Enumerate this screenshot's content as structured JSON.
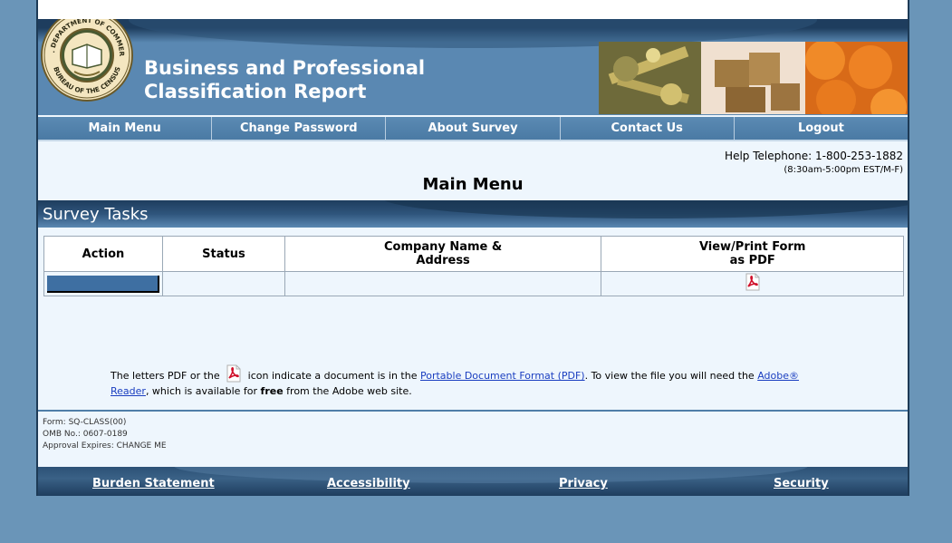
{
  "header": {
    "title": "Business and Professional\nClassification Report",
    "seal": {
      "top_text": "U.S. DEPARTMENT OF COMMERCE",
      "bottom_text": "BUREAU OF THE CENSUS"
    }
  },
  "nav": {
    "items": [
      {
        "label": "Main Menu"
      },
      {
        "label": "Change Password"
      },
      {
        "label": "About Survey"
      },
      {
        "label": "Contact Us"
      },
      {
        "label": "Logout"
      }
    ]
  },
  "help": {
    "telephone": "Help Telephone: 1-800-253-1882",
    "hours": "(8:30am-5:00pm EST/M-F)"
  },
  "page_title": "Main Menu",
  "section": {
    "title": "Survey Tasks"
  },
  "table": {
    "headers": [
      "Action",
      "Status",
      "Company Name &\nAddress",
      "View/Print Form\nas PDF"
    ],
    "rows": [
      {
        "action": "",
        "status": "",
        "company": "",
        "pdf_icon": "pdf-icon"
      }
    ]
  },
  "pdf_note": {
    "part1": "The letters PDF or the",
    "part2": "icon indicate a document is in the",
    "link1": "Portable Document Format (PDF)",
    "part3": ". To view the file you will need the",
    "link2": "Adobe® Reader",
    "part4": ", which is available for",
    "bold": "free",
    "part5": "from the Adobe web site."
  },
  "form_info": {
    "form": "Form: SQ-CLASS(00)",
    "omb": "OMB No.: 0607-0189",
    "approval": "Approval Expires: CHANGE ME"
  },
  "footer": {
    "links": [
      "Burden Statement",
      "Accessibility",
      "Privacy",
      "Security"
    ]
  },
  "colors": {
    "background": "#6a95b8",
    "nav": "#4f7ea8",
    "banner_dark": "#1e3d5e",
    "content_bg": "#eef6fd",
    "link": "#1a3ec0"
  }
}
